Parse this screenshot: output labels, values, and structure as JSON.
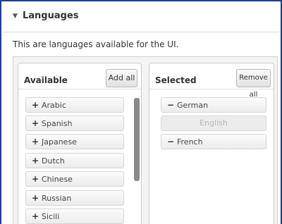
{
  "section": {
    "title": "Languages",
    "arrow_icon": "triangle-down-icon"
  },
  "description": "This are languages available for the UI.",
  "available": {
    "title": "Available",
    "button_label": "Add all",
    "items": [
      {
        "sign": "+",
        "label": "Arabic"
      },
      {
        "sign": "+",
        "label": "Spanish"
      },
      {
        "sign": "+",
        "label": "Japanese"
      },
      {
        "sign": "+",
        "label": "Dutch"
      },
      {
        "sign": "+",
        "label": "Chinese"
      },
      {
        "sign": "+",
        "label": "Russian"
      },
      {
        "sign": "+",
        "label": "Sicili"
      }
    ]
  },
  "selected": {
    "title": "Selected",
    "button_label": "Remove all",
    "items": [
      {
        "sign": "−",
        "label": "German"
      },
      {
        "sign": "",
        "label": "English"
      },
      {
        "sign": "−",
        "label": "French"
      }
    ]
  },
  "colors": {
    "frame_border": "#1a3f8c",
    "panel_background": "#f4f4f4",
    "disabled_text": "#b5b5b5"
  }
}
